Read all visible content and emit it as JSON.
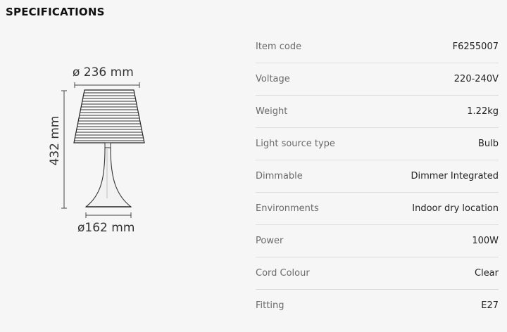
{
  "header": {
    "title": "SPECIFICATIONS"
  },
  "drawing": {
    "shade_diameter": "ø 236 mm",
    "base_diameter": "ø162 mm",
    "height": "432 mm"
  },
  "specs": [
    {
      "label": "Item code",
      "value": "F6255007"
    },
    {
      "label": "Voltage",
      "value": "220-240V"
    },
    {
      "label": "Weight",
      "value": "1.22kg"
    },
    {
      "label": "Light source type",
      "value": "Bulb"
    },
    {
      "label": "Dimmable",
      "value": "Dimmer Integrated"
    },
    {
      "label": "Environments",
      "value": "Indoor dry location"
    },
    {
      "label": "Power",
      "value": "100W"
    },
    {
      "label": "Cord Colour",
      "value": "Clear"
    },
    {
      "label": "Fitting",
      "value": "E27"
    }
  ],
  "colors": {
    "background": "#f6f6f6",
    "divider": "#dddddd",
    "label": "#6a6a6a",
    "value": "#222222"
  }
}
